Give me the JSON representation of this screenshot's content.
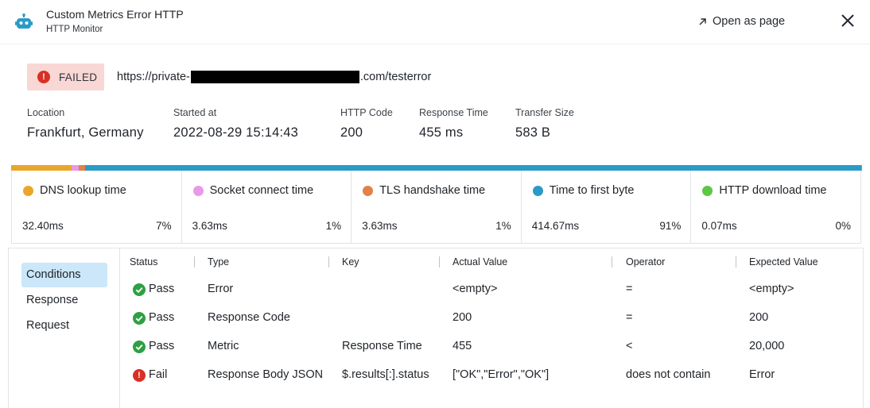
{
  "header": {
    "title": "Custom Metrics Error HTTP",
    "subtitle": "HTTP Monitor",
    "open_as_page": "Open as page"
  },
  "status": {
    "label": "FAILED",
    "url_prefix": "https://private-",
    "url_suffix": ".com/testerror"
  },
  "meta": [
    {
      "label": "Location",
      "value": "Frankfurt, Germany"
    },
    {
      "label": "Started at",
      "value": "2022-08-29 15:14:43"
    },
    {
      "label": "HTTP Code",
      "value": "200"
    },
    {
      "label": "Response Time",
      "value": "455 ms"
    },
    {
      "label": "Transfer Size",
      "value": "583 B"
    }
  ],
  "timings": [
    {
      "name": "DNS lookup time",
      "ms": "32.40ms",
      "pct": "7%",
      "share": 7.12,
      "color": "#eaa62b"
    },
    {
      "name": "Socket connect time",
      "ms": "3.63ms",
      "pct": "1%",
      "share": 0.8,
      "color": "#e89ae6"
    },
    {
      "name": "TLS handshake time",
      "ms": "3.63ms",
      "pct": "1%",
      "share": 0.8,
      "color": "#e0824a"
    },
    {
      "name": "Time to first byte",
      "ms": "414.67ms",
      "pct": "91%",
      "share": 91.26,
      "color": "#2b9ac6"
    },
    {
      "name": "HTTP download time",
      "ms": "0.07ms",
      "pct": "0%",
      "share": 0.02,
      "color": "#5cc745"
    }
  ],
  "tabs": [
    "Conditions",
    "Response",
    "Request"
  ],
  "conditions": {
    "headers": [
      "Status",
      "Type",
      "Key",
      "Actual Value",
      "Operator",
      "Expected Value"
    ],
    "rows": [
      {
        "status": "Pass",
        "type": "Error",
        "key": "",
        "actual": "<empty>",
        "operator": "=",
        "expected": "<empty>"
      },
      {
        "status": "Pass",
        "type": "Response Code",
        "key": "",
        "actual": "200",
        "operator": "=",
        "expected": "200"
      },
      {
        "status": "Pass",
        "type": "Metric",
        "key": "Response Time",
        "actual": "455",
        "operator": "<",
        "expected": "20,000"
      },
      {
        "status": "Fail",
        "type": "Response Body JSON",
        "key": "$.results[:].status",
        "actual": "[\"OK\",\"Error\",\"OK\"]",
        "operator": "does not contain",
        "expected": "Error"
      }
    ]
  },
  "colors": {
    "pass": "#2ea043",
    "fail": "#d93025",
    "accent": "#2b9ac6",
    "active_tab": "#cbe7f9"
  }
}
